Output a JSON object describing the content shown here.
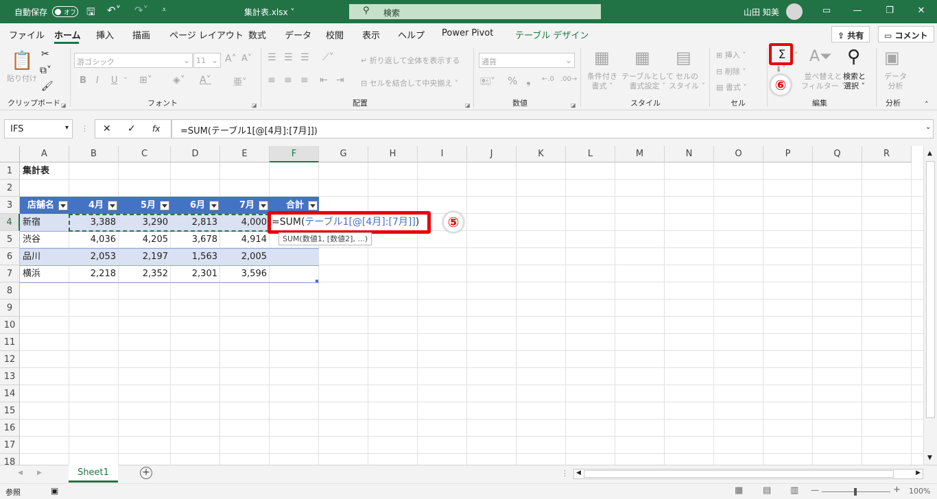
{
  "titlebar": {
    "autosave_label": "自動保存",
    "autosave_state": "オフ",
    "filename": "集計表.xlsx",
    "search_placeholder": "検索",
    "user_name": "山田 知美"
  },
  "tabs": [
    "ファイル",
    "ホーム",
    "挿入",
    "描画",
    "ページ レイアウト",
    "数式",
    "データ",
    "校閲",
    "表示",
    "ヘルプ",
    "Power Pivot",
    "テーブル デザイン"
  ],
  "top_buttons": {
    "share": "共有",
    "comment": "コメント"
  },
  "ribbon": {
    "clipboard": {
      "paste": "貼り付け",
      "group": "クリップボード"
    },
    "font": {
      "font_name": "游ゴシック",
      "font_size": "11",
      "grow": "A^",
      "shrink": "A˅",
      "bold": "B",
      "italic": "I",
      "underline": "U",
      "group": "フォント"
    },
    "alignment": {
      "wrap": "折り返して全体を表示する",
      "merge": "セルを結合して中央揃え",
      "group": "配置"
    },
    "number": {
      "format": "通貨",
      "group": "数値"
    },
    "styles": {
      "conditional": [
        "条件付き",
        "書式"
      ],
      "table": [
        "テーブルとして",
        "書式設定"
      ],
      "cell": [
        "セルの",
        "スタイル"
      ],
      "group": "スタイル"
    },
    "cells": {
      "insert": "挿入",
      "delete": "削除",
      "format": "書式",
      "group": "セル"
    },
    "editing": {
      "sort": [
        "並べ替えと",
        "フィルター"
      ],
      "find": [
        "検索と",
        "選択"
      ],
      "group": "編集"
    },
    "analysis": {
      "analyze": [
        "データ",
        "分析"
      ],
      "group": "分析"
    }
  },
  "formula_bar": {
    "name_box": "IFS",
    "formula": "=SUM(テーブル1[@[4月]:[7月]])"
  },
  "columns": [
    "A",
    "B",
    "C",
    "D",
    "E",
    "F",
    "G",
    "H",
    "I",
    "J",
    "K",
    "L",
    "M",
    "N",
    "O",
    "P",
    "Q",
    "R"
  ],
  "rows": [
    "1",
    "2",
    "3",
    "4",
    "5",
    "6",
    "7",
    "8",
    "9",
    "10",
    "11",
    "12",
    "13",
    "14",
    "15",
    "16",
    "17",
    "18"
  ],
  "sheet": {
    "title": "集計表",
    "headers": [
      "店舗名",
      "4月",
      "5月",
      "6月",
      "7月",
      "合計"
    ],
    "data": [
      [
        "新宿",
        "3,388",
        "3,290",
        "2,813",
        "4,000"
      ],
      [
        "渋谷",
        "4,036",
        "4,205",
        "3,678",
        "4,914"
      ],
      [
        "品川",
        "2,053",
        "2,197",
        "1,563",
        "2,005"
      ],
      [
        "横浜",
        "2,218",
        "2,352",
        "2,301",
        "3,596"
      ]
    ],
    "edit_prefix": "=SUM(",
    "edit_ref": "テーブル1[@[4月]:[7月]]",
    "edit_suffix": ")",
    "tooltip": "SUM(数値1, [数値2], ...)"
  },
  "annotations": {
    "step5": "⑤",
    "step6": "⑥"
  },
  "sheet_tabs": [
    "Sheet1"
  ],
  "status": {
    "mode": "参照",
    "zoom": "100%"
  },
  "colors": {
    "brand": "#217346",
    "table_header": "#4472c4",
    "band": "#d9e1f2",
    "highlight": "#e60000"
  }
}
